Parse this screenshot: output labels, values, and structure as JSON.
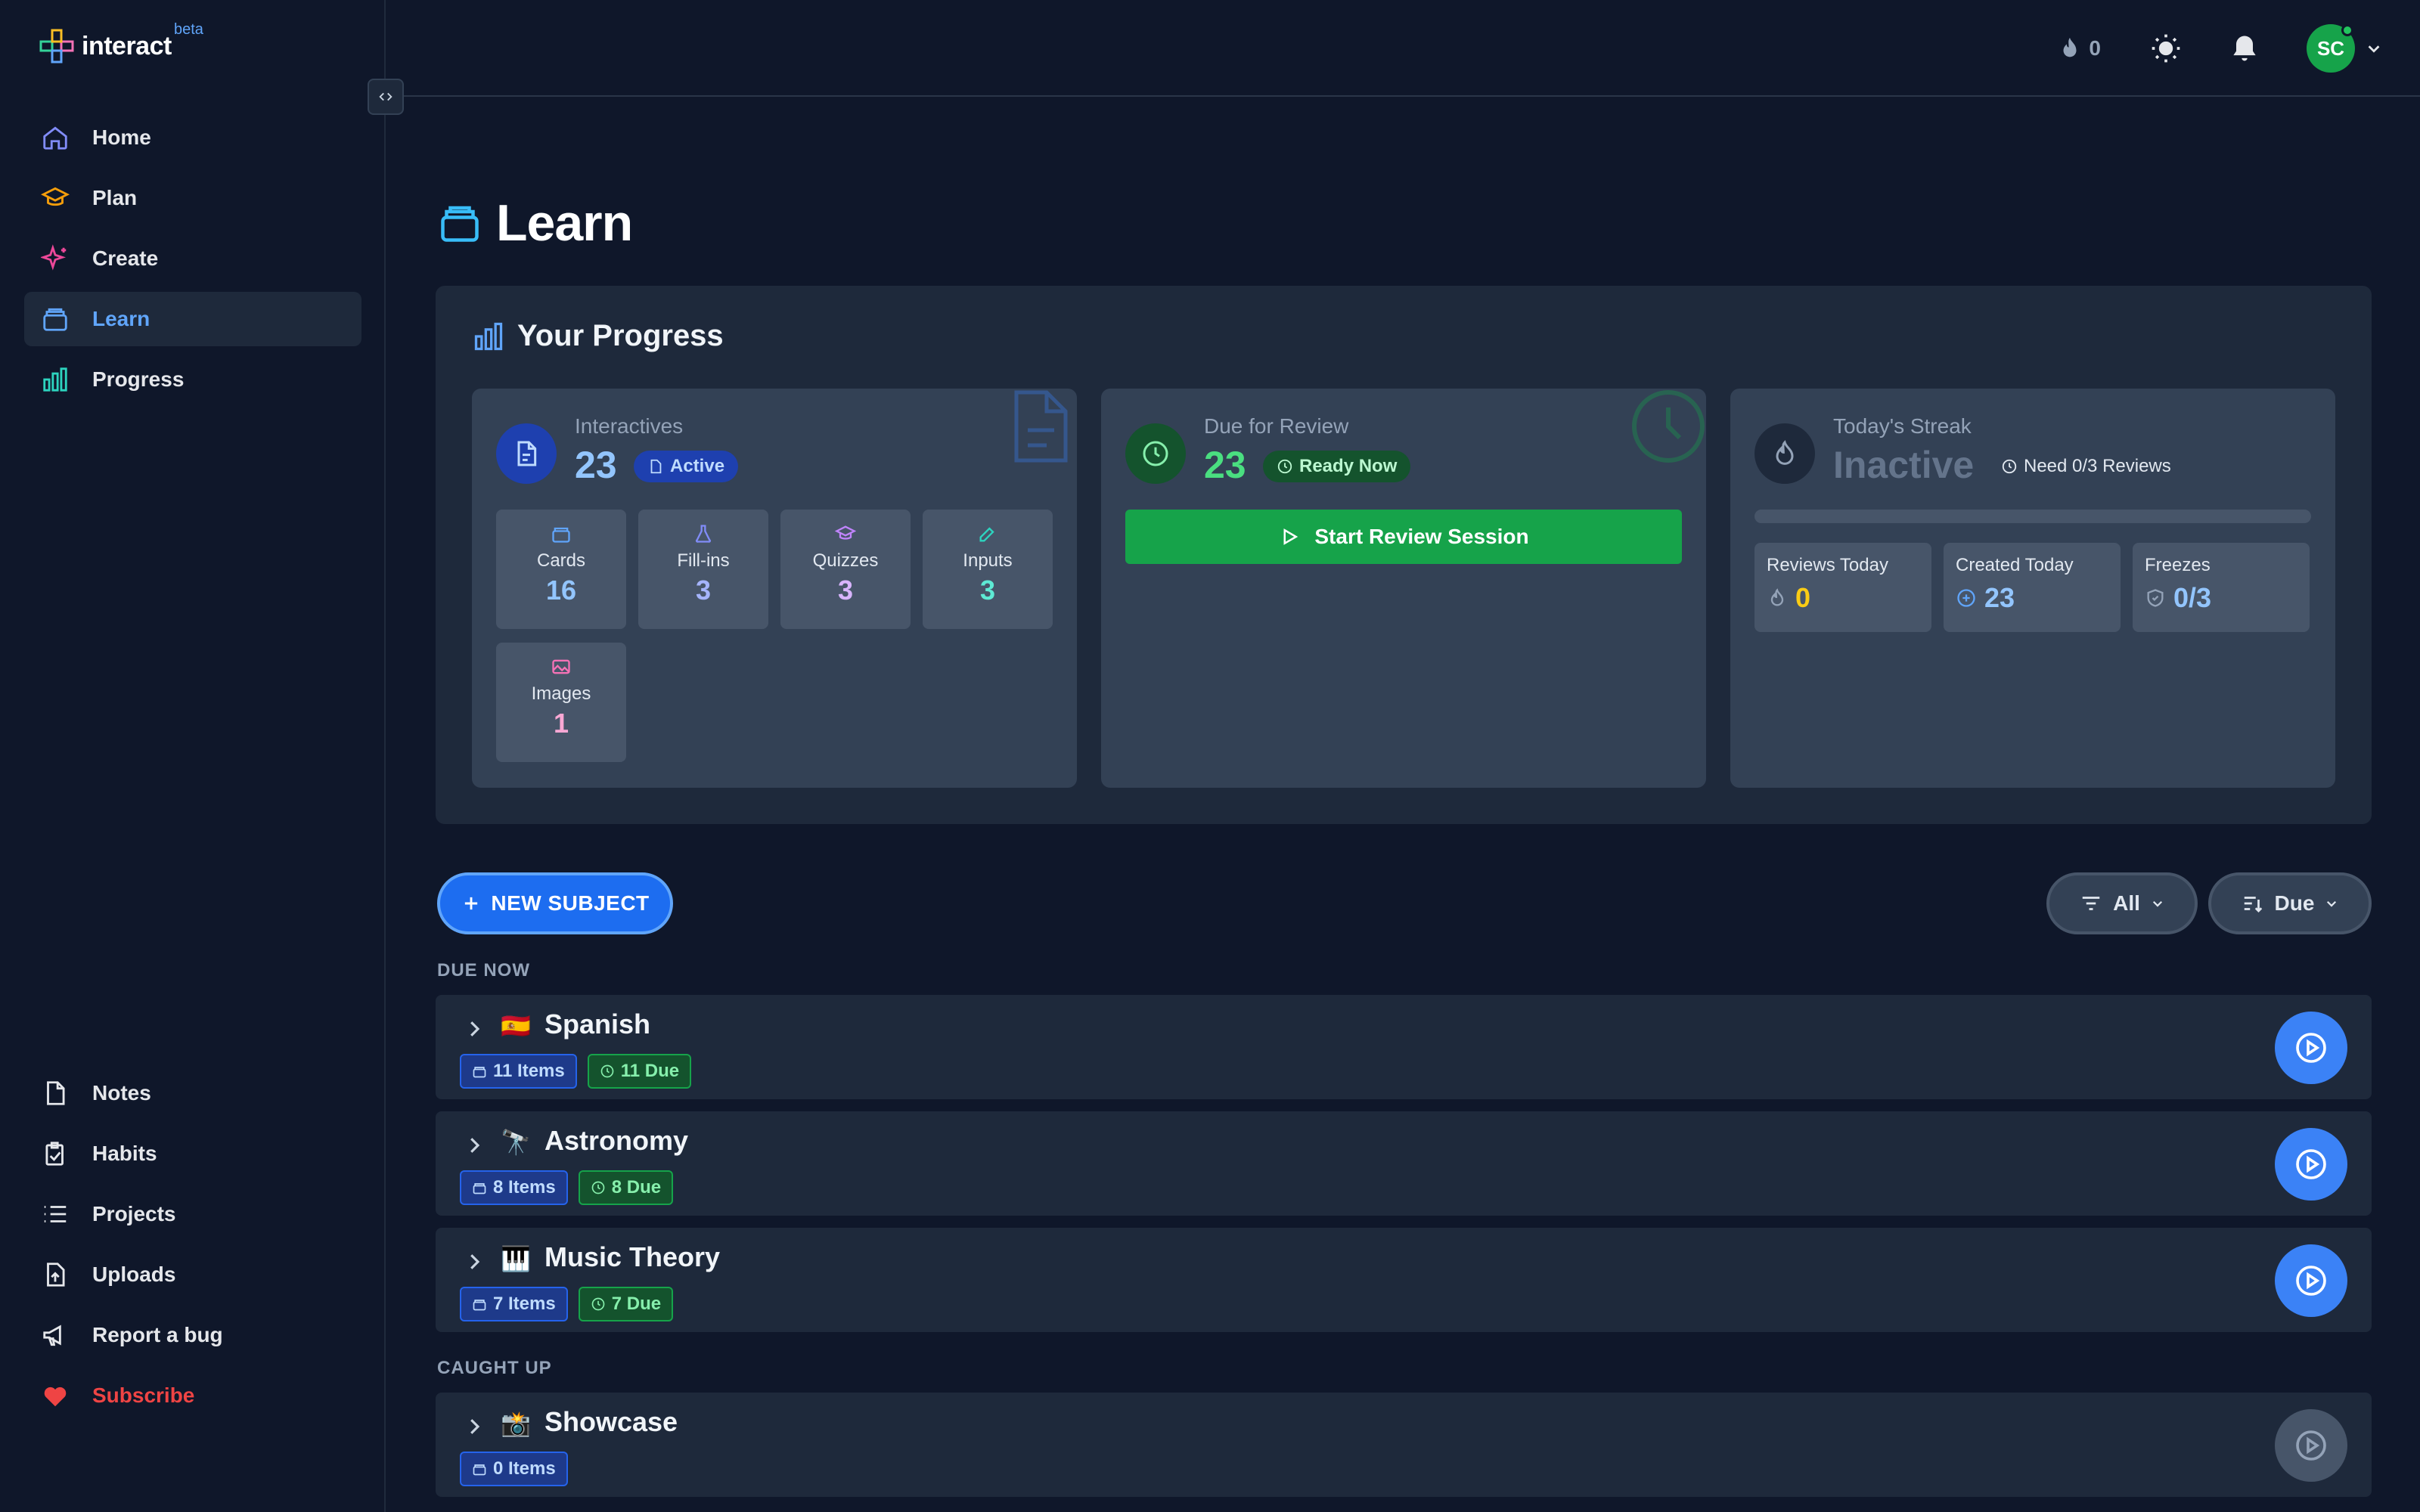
{
  "app": {
    "name": "interact",
    "badge": "beta"
  },
  "sidebar": {
    "top_items": [
      {
        "label": "Home",
        "icon": "home-icon"
      },
      {
        "label": "Plan",
        "icon": "graduation-cap-icon"
      },
      {
        "label": "Create",
        "icon": "sparkles-icon"
      },
      {
        "label": "Learn",
        "icon": "card-stack-icon",
        "active": true
      },
      {
        "label": "Progress",
        "icon": "bar-chart-icon"
      }
    ],
    "bottom_items": [
      {
        "label": "Notes",
        "icon": "file-icon"
      },
      {
        "label": "Habits",
        "icon": "clipboard-check-icon"
      },
      {
        "label": "Projects",
        "icon": "list-icon"
      },
      {
        "label": "Uploads",
        "icon": "file-upload-icon"
      },
      {
        "label": "Report a bug",
        "icon": "megaphone-icon"
      },
      {
        "label": "Subscribe",
        "icon": "heart-icon"
      }
    ]
  },
  "topbar": {
    "streak_count": "0",
    "avatar_initials": "SC"
  },
  "page": {
    "title": "Learn"
  },
  "progress": {
    "title": "Your Progress",
    "interactives": {
      "label": "Interactives",
      "count": "23",
      "status": "Active",
      "types": [
        {
          "label": "Cards",
          "value": "16",
          "color": "#93c5fd"
        },
        {
          "label": "Fill-ins",
          "value": "3",
          "color": "#a5b4fc"
        },
        {
          "label": "Quizzes",
          "value": "3",
          "color": "#d8b4fe"
        },
        {
          "label": "Inputs",
          "value": "3",
          "color": "#5eead4"
        },
        {
          "label": "Images",
          "value": "1",
          "color": "#f9a8d4"
        }
      ]
    },
    "due": {
      "label": "Due for Review",
      "count": "23",
      "status": "Ready Now",
      "button": "Start Review Session"
    },
    "streak": {
      "label": "Today's Streak",
      "status": "Inactive",
      "requirement": "Need 0/3 Reviews",
      "progress_fraction": 0,
      "stats": [
        {
          "label": "Reviews Today",
          "value": "0",
          "color": "#facc15"
        },
        {
          "label": "Created Today",
          "value": "23",
          "color": "#93c5fd"
        },
        {
          "label": "Freezes",
          "value": "0/3",
          "color": "#93c5fd"
        }
      ]
    }
  },
  "controls": {
    "new_subject": "NEW SUBJECT",
    "filter": "All",
    "sort": "Due"
  },
  "sections": {
    "due_now": "DUE NOW",
    "caught_up": "CAUGHT UP"
  },
  "subjects": [
    {
      "name": "Spanish",
      "emoji": "🇪🇸",
      "items": "11 Items",
      "due": "11 Due"
    },
    {
      "name": "Astronomy",
      "emoji": "🔭",
      "items": "8 Items",
      "due": "8 Due"
    },
    {
      "name": "Music Theory",
      "emoji": "🎹",
      "items": "7 Items",
      "due": "7 Due"
    },
    {
      "name": "Showcase",
      "emoji": "📸",
      "items": "0 Items"
    }
  ],
  "colors": {
    "accent": "#3b82f6",
    "success": "#16a34a",
    "background": "#0f172a",
    "panel": "#1e293b"
  }
}
